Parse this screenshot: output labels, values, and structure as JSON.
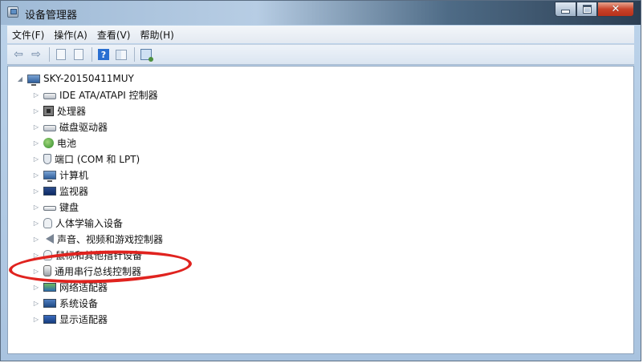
{
  "window": {
    "title": "设备管理器",
    "icons": {
      "app": "device-manager-icon",
      "minimize": "minimize-icon",
      "maximize": "maximize-icon",
      "close": "close-icon"
    }
  },
  "menu": {
    "items": [
      {
        "label": "文件(F)"
      },
      {
        "label": "操作(A)"
      },
      {
        "label": "查看(V)"
      },
      {
        "label": "帮助(H)"
      }
    ]
  },
  "toolbar": {
    "back_glyph": "⇦",
    "forward_glyph": "⇨",
    "help_glyph": "?",
    "buttons": [
      "back-icon",
      "forward-icon",
      "properties-icon",
      "update-driver-icon",
      "help-icon",
      "view-grid-icon",
      "scan-hardware-icon"
    ]
  },
  "tree": {
    "root": {
      "label": "SKY-20150411MUY",
      "expander": "◢",
      "icon": "computer-icon"
    },
    "expander_collapsed": "▷",
    "items": [
      {
        "label": "IDE ATA/ATAPI 控制器",
        "icon": "ide-controller-icon"
      },
      {
        "label": "处理器",
        "icon": "processor-icon"
      },
      {
        "label": "磁盘驱动器",
        "icon": "disk-drive-icon"
      },
      {
        "label": "电池",
        "icon": "battery-icon"
      },
      {
        "label": "端口 (COM 和 LPT)",
        "icon": "port-icon"
      },
      {
        "label": "计算机",
        "icon": "computer-icon"
      },
      {
        "label": "监视器",
        "icon": "monitor-icon"
      },
      {
        "label": "键盘",
        "icon": "keyboard-icon"
      },
      {
        "label": "人体学输入设备",
        "icon": "hid-icon"
      },
      {
        "label": "声音、视频和游戏控制器",
        "icon": "sound-icon"
      },
      {
        "label": "鼠标和其他指针设备",
        "icon": "mouse-icon"
      },
      {
        "label": "通用串行总线控制器",
        "icon": "usb-icon"
      },
      {
        "label": "网络适配器",
        "icon": "network-icon"
      },
      {
        "label": "系统设备",
        "icon": "system-device-icon"
      },
      {
        "label": "显示适配器",
        "icon": "display-adapter-icon"
      }
    ]
  },
  "annotation": {
    "color": "#e0231f",
    "target": "通用串行总线控制器"
  }
}
